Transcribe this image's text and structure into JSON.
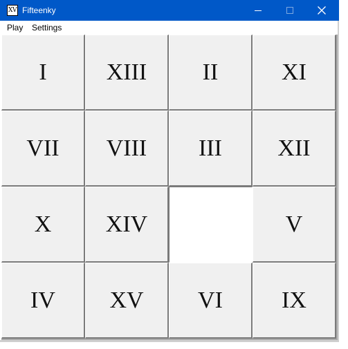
{
  "window": {
    "title": "Fifteenky",
    "icon_text": "XV",
    "titlebar_color": "#0058c8"
  },
  "menu": {
    "play": "Play",
    "settings": "Settings"
  },
  "board": {
    "rows": 4,
    "cols": 4,
    "tiles": [
      [
        "I",
        "XIII",
        "II",
        "XI"
      ],
      [
        "VII",
        "VIII",
        "III",
        "XII"
      ],
      [
        "X",
        "XIV",
        "",
        "V"
      ],
      [
        "IV",
        "XV",
        "VI",
        "IX"
      ]
    ],
    "empty_cell": {
      "row": 3,
      "col": 3
    }
  }
}
